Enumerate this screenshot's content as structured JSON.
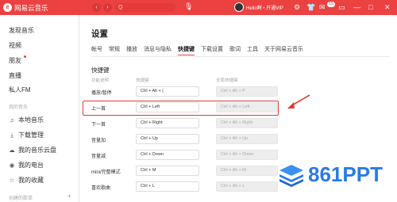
{
  "titlebar": {
    "app_name": "网易云音乐",
    "logo_glyph": "e",
    "nav_back": "‹",
    "nav_forward": "›",
    "search_placeholder": "Q",
    "mic_glyph": "🎙",
    "username": "Hello啊 • 开通VIP",
    "message_badge": "15",
    "accent": "#ec4141"
  },
  "sidebar": {
    "items_top": [
      {
        "label": "发现音乐"
      },
      {
        "label": "视频"
      },
      {
        "label": "朋友"
      },
      {
        "label": "直播"
      },
      {
        "label": "私人FM"
      }
    ],
    "section_my_music": "我的音乐",
    "items_mine": [
      {
        "label": "本地音乐",
        "icon": "music-note-icon",
        "glyph": "♫"
      },
      {
        "label": "下载管理",
        "icon": "download-icon",
        "glyph": "⤓"
      },
      {
        "label": "我的音乐云盘",
        "icon": "cloud-icon",
        "glyph": "☁"
      },
      {
        "label": "我的电台",
        "icon": "radio-icon",
        "glyph": "◉"
      },
      {
        "label": "我的收藏",
        "icon": "star-icon",
        "glyph": "☆"
      }
    ],
    "section_created": "创建的歌单",
    "plus": "+"
  },
  "main": {
    "title": "设置",
    "tabs": [
      {
        "label": "帐号"
      },
      {
        "label": "常规"
      },
      {
        "label": "播放"
      },
      {
        "label": "消息与隐私"
      },
      {
        "label": "快捷键",
        "active": true
      },
      {
        "label": "下载设置"
      },
      {
        "label": "歌词"
      },
      {
        "label": "工具"
      },
      {
        "label": "关于网易云音乐"
      }
    ],
    "section_title": "快捷键",
    "col_function": "功能说明",
    "col_shortcut": "快捷键",
    "col_global": "全局快捷键",
    "rows": [
      {
        "label": "播放/暂停",
        "key": "Ctrl + Alt + |",
        "global": "Ctrl + Alt + P"
      },
      {
        "label": "上一首",
        "key": "Ctrl + Left",
        "global": "Ctrl + Alt + Left"
      },
      {
        "label": "下一首",
        "key": "Ctrl + Right",
        "global": "Ctrl + Alt + Right"
      },
      {
        "label": "音量加",
        "key": "Ctrl + Up",
        "global": "Ctrl + Alt + Up"
      },
      {
        "label": "音量减",
        "key": "Ctrl + Down",
        "global": "Ctrl + Alt + Down"
      },
      {
        "label": "mini/完整模式",
        "key": "Ctrl + M",
        "global": "Ctrl + Alt + M"
      },
      {
        "label": "喜欢歌曲",
        "key": "Ctrl + L",
        "global": "Ctrl + Alt + L"
      }
    ]
  },
  "watermark": {
    "text": "861PPT",
    "color": "#2a7ae8"
  },
  "annotation_color": "#e53935"
}
